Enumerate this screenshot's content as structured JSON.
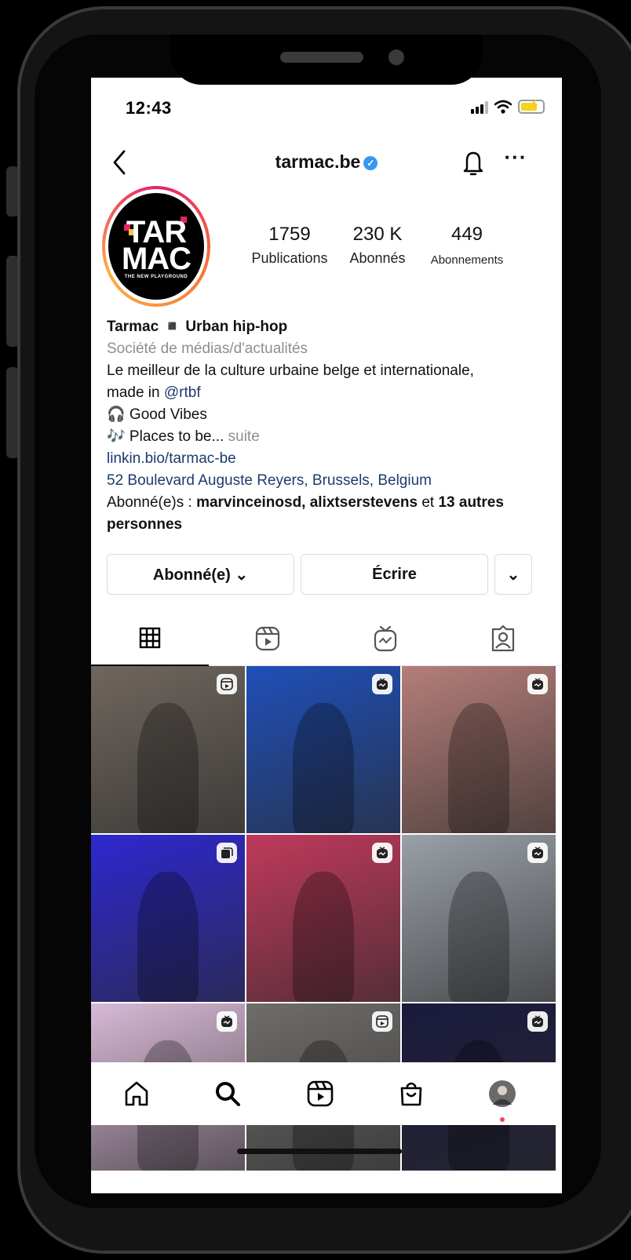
{
  "status_bar": {
    "time": "12:43"
  },
  "header": {
    "username": "tarmac.be",
    "verified_icon": "verified-badge-icon"
  },
  "avatar": {
    "logo_line1": "TAR",
    "logo_line2": "MAC",
    "logo_tagline": "THE NEW PLAYGROUND"
  },
  "stats": [
    {
      "value": "1759",
      "label": "Publications"
    },
    {
      "value": "230 K",
      "label": "Abonnés"
    },
    {
      "value": "449",
      "label": "Abonnements"
    }
  ],
  "bio": {
    "name": "Tarmac ◾ Urban hip-hop",
    "category": "Société de médias/d'actualités",
    "line1": "Le meilleur de la culture urbaine belge et internationale,",
    "line2_prefix": "made in ",
    "line2_mention": "@rtbf",
    "line3": "🎧 Good Vibes",
    "line4": "🎶 Places to be...",
    "more": "suite",
    "link": "linkin.bio/tarmac-be",
    "address": "52 Boulevard Auguste Reyers, Brussels, Belgium",
    "followed_prefix": "Abonné(e)s : ",
    "followed_names": "marvinceinosd, alixtserstevens",
    "followed_and": " et ",
    "followed_others": "13 autres personnes"
  },
  "actions": {
    "following": "Abonné(e) ⌄",
    "message": "Écrire",
    "dropdown": "⌄"
  },
  "tabs": [
    "grid-icon",
    "reels-icon",
    "igtv-icon",
    "tagged-icon"
  ],
  "grid": [
    {
      "badge": "reels-icon",
      "bg": "#6f665e"
    },
    {
      "badge": "igtv-icon",
      "bg": "#1f4fb8"
    },
    {
      "badge": "igtv-icon",
      "bg": "#b57e79"
    },
    {
      "badge": "carousel-icon",
      "bg": "#2d28d0"
    },
    {
      "badge": "igtv-icon",
      "bg": "#c0395c"
    },
    {
      "badge": "igtv-icon",
      "bg": "#9aa0a8"
    },
    {
      "badge": "igtv-icon",
      "bg": "#d8b9d6"
    },
    {
      "badge": "reels-icon",
      "bg": "#6f6d6a"
    },
    {
      "badge": "igtv-icon",
      "bg": "#1a1a3e"
    }
  ],
  "bottom_nav": [
    "home-icon",
    "search-icon",
    "reels-icon",
    "shop-icon",
    "profile-avatar"
  ]
}
